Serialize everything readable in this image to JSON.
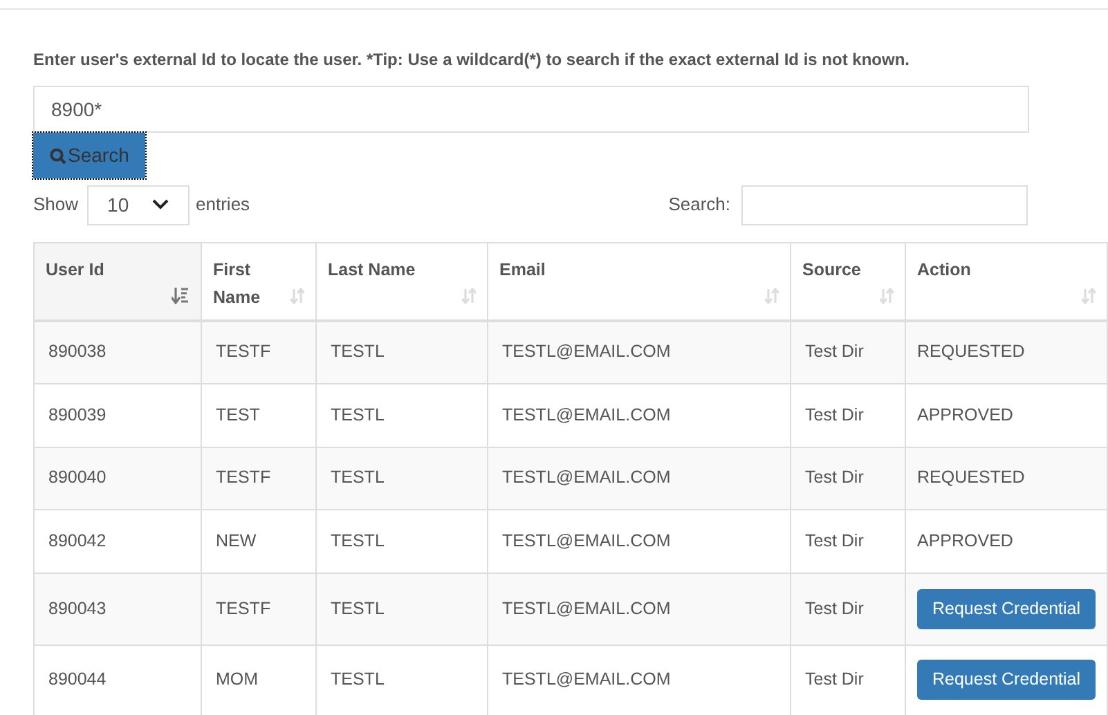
{
  "instructions": "Enter user's external Id to locate the user. *Tip: Use a wildcard(*) to search if the exact external Id is not known.",
  "id_field": {
    "value": "8900*"
  },
  "search_button": {
    "label": "Search"
  },
  "length_menu": {
    "prefix": "Show",
    "value": "10",
    "suffix": "entries"
  },
  "table_search": {
    "label": "Search:"
  },
  "table": {
    "columns": [
      {
        "label": "User Id",
        "sorted": true
      },
      {
        "label": "First Name",
        "sorted": false
      },
      {
        "label": "Last Name",
        "sorted": false
      },
      {
        "label": "Email",
        "sorted": false
      },
      {
        "label": "Source",
        "sorted": false
      },
      {
        "label": "Action",
        "sorted": false
      }
    ],
    "rows": [
      {
        "user_id": "890038",
        "first_name": "TESTF",
        "last_name": "TESTL",
        "email": "TESTL@EMAIL.COM",
        "source": "Test Dir",
        "action": {
          "kind": "text",
          "label": "REQUESTED"
        }
      },
      {
        "user_id": "890039",
        "first_name": "TEST",
        "last_name": "TESTL",
        "email": "TESTL@EMAIL.COM",
        "source": "Test Dir",
        "action": {
          "kind": "text",
          "label": "APPROVED"
        }
      },
      {
        "user_id": "890040",
        "first_name": "TESTF",
        "last_name": "TESTL",
        "email": "TESTL@EMAIL.COM",
        "source": "Test Dir",
        "action": {
          "kind": "text",
          "label": "REQUESTED"
        }
      },
      {
        "user_id": "890042",
        "first_name": "NEW",
        "last_name": "TESTL",
        "email": "TESTL@EMAIL.COM",
        "source": "Test Dir",
        "action": {
          "kind": "text",
          "label": "APPROVED"
        }
      },
      {
        "user_id": "890043",
        "first_name": "TESTF",
        "last_name": "TESTL",
        "email": "TESTL@EMAIL.COM",
        "source": "Test Dir",
        "action": {
          "kind": "button",
          "label": "Request Credential"
        }
      },
      {
        "user_id": "890044",
        "first_name": "MOM",
        "last_name": "TESTL",
        "email": "TESTL@EMAIL.COM",
        "source": "Test Dir",
        "action": {
          "kind": "button",
          "label": "Request Credential"
        }
      }
    ]
  }
}
